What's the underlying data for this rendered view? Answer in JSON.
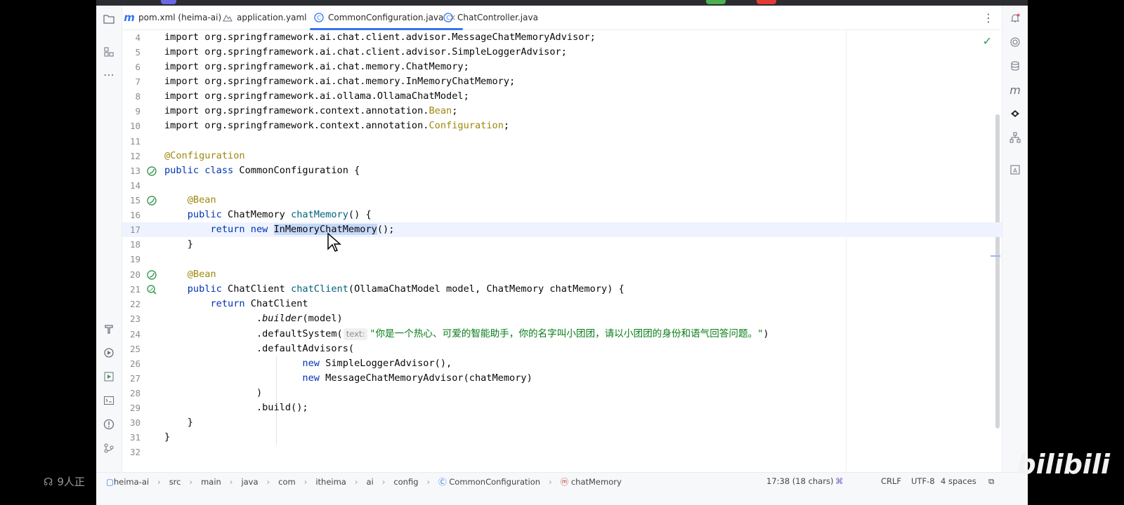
{
  "tabs": [
    {
      "label": "pom.xml (heima-ai)",
      "icon": "maven-icon",
      "active": false
    },
    {
      "label": "application.yaml",
      "icon": "yaml-icon",
      "active": false
    },
    {
      "label": "CommonConfiguration.java",
      "icon": "class-icon",
      "active": true,
      "close": "×"
    },
    {
      "label": "ChatController.java",
      "icon": "class-icon",
      "active": false
    }
  ],
  "code_lines": [
    {
      "n": "4"
    },
    {
      "n": "5"
    },
    {
      "n": "6"
    },
    {
      "n": "7"
    },
    {
      "n": "8"
    },
    {
      "n": "9"
    },
    {
      "n": "10"
    },
    {
      "n": "11"
    },
    {
      "n": "12"
    },
    {
      "n": "13"
    },
    {
      "n": "14"
    },
    {
      "n": "15"
    },
    {
      "n": "16"
    },
    {
      "n": "17"
    },
    {
      "n": "18"
    },
    {
      "n": "19"
    },
    {
      "n": "20"
    },
    {
      "n": "21"
    },
    {
      "n": "22"
    },
    {
      "n": "23"
    },
    {
      "n": "24"
    },
    {
      "n": "25"
    },
    {
      "n": "26"
    },
    {
      "n": "27"
    },
    {
      "n": "28"
    },
    {
      "n": "29"
    },
    {
      "n": "30"
    },
    {
      "n": "31"
    },
    {
      "n": "32"
    }
  ],
  "code": {
    "l4": "import org.springframework.ai.chat.client.advisor.MessageChatMemoryAdvisor;",
    "l5": "import org.springframework.ai.chat.client.advisor.SimpleLoggerAdvisor;",
    "l6": "import org.springframework.ai.chat.memory.ChatMemory;",
    "l7": "import org.springframework.ai.chat.memory.InMemoryChatMemory;",
    "l8": "import org.springframework.ai.ollama.OllamaChatModel;",
    "l9a": "import org.springframework.context.annotation.",
    "l9b": "Bean",
    "l10a": "import org.springframework.context.annotation.",
    "l10b": "Configuration",
    "semi": ";",
    "l12": "@Configuration",
    "l13a": "public class",
    "l13b": " CommonConfiguration {",
    "bean": "@Bean",
    "l16a": "public",
    "l16b": " ChatMemory ",
    "l16c": "chatMemory",
    "l16d": "() {",
    "l17a": "return new",
    "l17b": "InMemoryChatMemory",
    "l17c": "();",
    "close": "}",
    "l21a": "public",
    "l21b": " ChatClient ",
    "l21c": "chatClient",
    "l21d": "(OllamaChatModel model, ChatMemory chatMemory) {",
    "l22a": "return",
    "l22b": " ChatClient",
    "l23a": ".",
    "l23b": "builder",
    "l23c": "(model)",
    "l24a": ".defaultSystem(",
    "l24hint": "text:",
    "l24str": "\"你是一个热心、可爱的智能助手，你的名字叫小团团，请以小团团的身份和语气回答问题。\"",
    "l24c": ")",
    "l25": ".defaultAdvisors(",
    "new": "new",
    "l26": " SimpleLoggerAdvisor(),",
    "l27": " MessageChatMemoryAdvisor(chatMemory)",
    "l28": ")",
    "l29": ".build();"
  },
  "status": {
    "crumbs": [
      "heima-ai",
      "src",
      "main",
      "java",
      "com",
      "itheima",
      "ai",
      "config",
      "CommonConfiguration",
      "chatMemory"
    ],
    "position": "17:38 (18 chars)",
    "line_sep": "CRLF",
    "encoding": "UTF-8",
    "indent": "4 spaces"
  },
  "overlay": {
    "viewers": "9人正",
    "watermark": "bilibili"
  },
  "colors": {
    "accent": "#3574f0",
    "keyword": "#0033b3",
    "annotation": "#9e880d",
    "string": "#067d17",
    "method": "#00627a"
  }
}
